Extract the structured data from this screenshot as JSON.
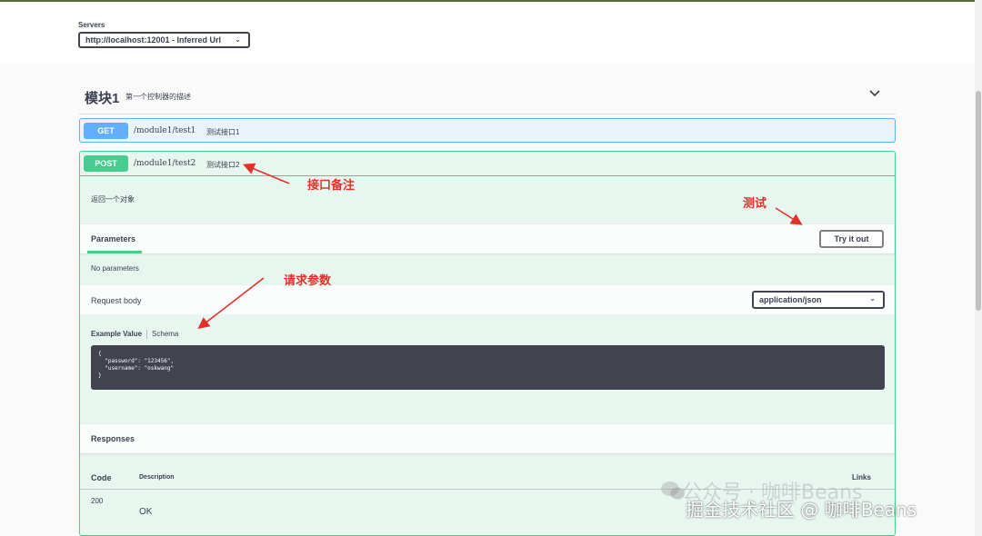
{
  "servers": {
    "label": "Servers",
    "selected": "http://localhost:12001 - Inferred Url"
  },
  "tag": {
    "name": "模块1",
    "description": "第一个控制器的描述"
  },
  "operations": [
    {
      "method": "GET",
      "path": "/module1/test1",
      "summary": "测试接口1"
    },
    {
      "method": "POST",
      "path": "/module1/test2",
      "summary": "测试接口2"
    }
  ],
  "post_detail": {
    "description": "返回一个对象",
    "parameters_tab": "Parameters",
    "try_button": "Try it out",
    "no_parameters": "No parameters",
    "request_body_label": "Request body",
    "content_type": "application/json",
    "example_value_tab": "Example Value",
    "schema_tab": "Schema",
    "example_code": "{\n  \"password\": \"123456\",\n  \"username\": \"oskwang\"\n}",
    "responses_label": "Responses",
    "responses_columns": {
      "code": "Code",
      "description": "Description",
      "links": "Links"
    },
    "responses": [
      {
        "code": "200",
        "description": "OK"
      }
    ]
  },
  "annotations": {
    "interface_note": "接口备注",
    "test": "测试",
    "request_params": "请求参数",
    "color": "#e0322a"
  },
  "watermark": {
    "line1": "公众号 · 咖啡Beans",
    "line2": "掘金技术社区 @ 咖啡Beans"
  },
  "colors": {
    "get": "#61affe",
    "post": "#49cc90",
    "post_bg": "#e8f6f0",
    "get_bg": "#ebf3fb"
  }
}
